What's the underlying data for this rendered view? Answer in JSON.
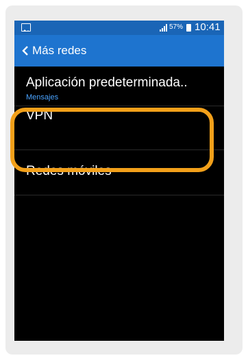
{
  "status_bar": {
    "battery_percent": "57%",
    "time": "10:41"
  },
  "header": {
    "title": "Más redes"
  },
  "settings": {
    "items": [
      {
        "label": "Aplicación predeterminada..",
        "sublabel": "Mensajes"
      },
      {
        "label": "VPN"
      },
      {
        "label": "Redes móviles"
      }
    ]
  },
  "colors": {
    "status_bar": "#1a65b6",
    "header": "#1e74cf",
    "sublabel": "#4aa3ff",
    "highlight": "#f2a01a"
  },
  "icons": {
    "status_left": "gallery-icon",
    "signal": "signal-icon",
    "battery": "battery-icon",
    "back": "back-arrow-icon"
  }
}
